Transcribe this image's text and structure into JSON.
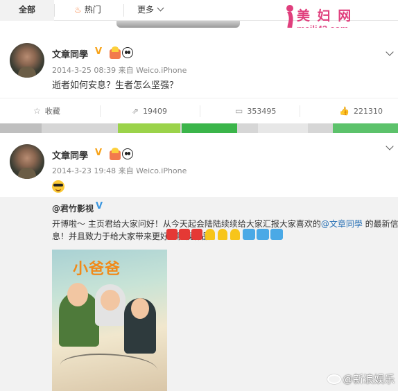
{
  "tabs": {
    "all": "全部",
    "hot": "热门",
    "more": "更多"
  },
  "watermark": {
    "title": "美 妇 网",
    "url": "meili43.com"
  },
  "posts": [
    {
      "username": "文章同學",
      "time": "2014-3-25 08:39",
      "source_prefix": "来自",
      "source": "Weico.iPhone",
      "text": "逝者如何安息？生者怎么坚强？",
      "actions": {
        "favorite": "收藏",
        "repost_count": "19409",
        "comment_count": "353495",
        "like_count": "221310"
      }
    },
    {
      "username": "文章同學",
      "time": "2014-3-23 19:48",
      "source_prefix": "来自",
      "source": "Weico.iPhone",
      "repost": {
        "user": "@君竹影视",
        "line1_a": "开博啦～ 主页君给大家问好！从今天起会陆陆续续给大家汇报大家喜欢的",
        "line1_mention": "@文章同學",
        "line1_b": " 的最新信",
        "line2": "息！并且致力于给大家带来更好的影视作品！"
      },
      "poster_title": "小爸爸"
    }
  ],
  "sina_watermark": "@新浪娱乐",
  "colors": {
    "orange_vip": "#f7a31a",
    "blue_verified": "#3b97e0",
    "link": "#2a72b5",
    "watermark_pink": "#e03f7d"
  }
}
